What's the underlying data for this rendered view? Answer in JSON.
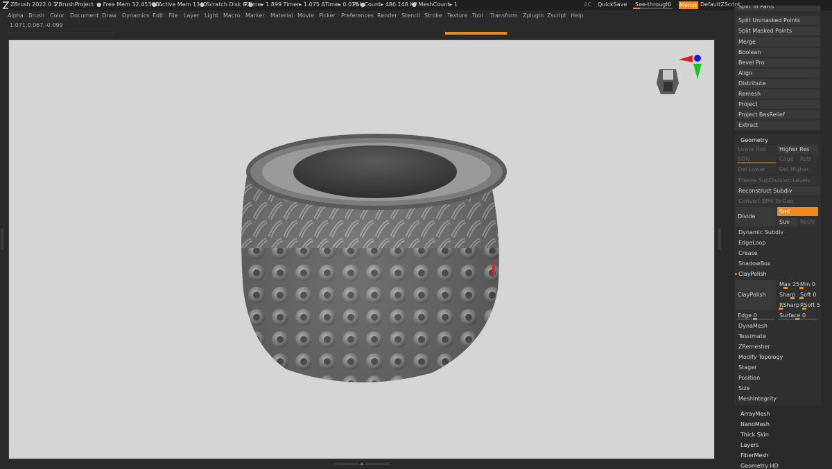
{
  "app": {
    "title": "ZBrush 2022.0.1",
    "project": "ZBrushProject",
    "free_mem": ". ● Free Mem 32.453GB",
    "active_mem": "● Active Mem 1340",
    "scratch_disk": "● Scratch Disk 8 ●",
    "rtime": "RTime▸ 1.899 Timer▸ 1.075 ATime▸ 0.015 ●",
    "polycount": "PolyCount▸ 486.148 KP",
    "meshcount": "● MeshCount▸ 1",
    "ac": "AC",
    "quicksave": "QuickSave",
    "seethrough": "See-through",
    "seethrough_value": "0",
    "seethrough_fraction": 0.0,
    "menus": "Menus",
    "default_zscript": "DefaultZScript"
  },
  "menu": [
    "Alpha",
    "Brush",
    "Color",
    "Document",
    "Draw",
    "Dynamics",
    "Edit",
    "File",
    "Layer",
    "Light",
    "Macro",
    "Marker",
    "Material",
    "Movie",
    "Picker",
    "Preferences",
    "Render",
    "Stencil",
    "Stroke",
    "Texture",
    "Tool",
    "Transform",
    "Zplugin",
    "Zscript",
    "Help"
  ],
  "coords": "1.071,0.067,-0.099",
  "subtool_panel": {
    "cut_item": "Split To Parts",
    "items": [
      "Split Unmasked Points",
      "Split Masked Points",
      "Merge",
      "Boolean",
      "Bevel Pro",
      "Align",
      "Distribute",
      "Remesh",
      "Project",
      "Project BasRelief",
      "Extract"
    ]
  },
  "geometry": {
    "header": "Geometry",
    "lower_res": "Lower Res",
    "higher_res": "Higher Res",
    "sdiv": "SDiv",
    "cage": "Cage",
    "rstr": "Rstr",
    "del_lower": "Del Lower",
    "del_higher": "Del Higher",
    "freeze": "Freeze SubDivision Levels",
    "reconstruct": "Reconstruct Subdiv",
    "convert_bpr": "Convert BPR To Geo",
    "divide": "Divide",
    "smt": "Smt",
    "suv": "Suv",
    "reuv": "ReUV",
    "dynamic_subdiv": "Dynamic Subdiv",
    "edgeloop": "EdgeLoop",
    "crease": "Crease",
    "shadowbox": "ShadowBox",
    "claypolish_toggle": "ClayPolish",
    "claypolish": "ClayPolish",
    "max": "Max 25",
    "min": "Min 0",
    "sharp": "Sharp",
    "soft": "Soft 0",
    "rsharp": "RSharp",
    "rsoft": "RSoft 5",
    "edge": "Edge 0",
    "surface": "Surface 0",
    "items_after": [
      "DynaMesh",
      "Tessimate",
      "ZRemesher",
      "Modify Topology",
      "Stager",
      "Position",
      "Size",
      "MeshIntegrity"
    ]
  },
  "bottom_list": [
    "ArrayMesh",
    "NanoMesh",
    "Thick Skin",
    "Layers",
    "FiberMesh",
    "Geometry HD"
  ],
  "colors": {
    "accent": "#ee8a1e",
    "canvas": "#d5d5d5",
    "panel": "#303030"
  }
}
